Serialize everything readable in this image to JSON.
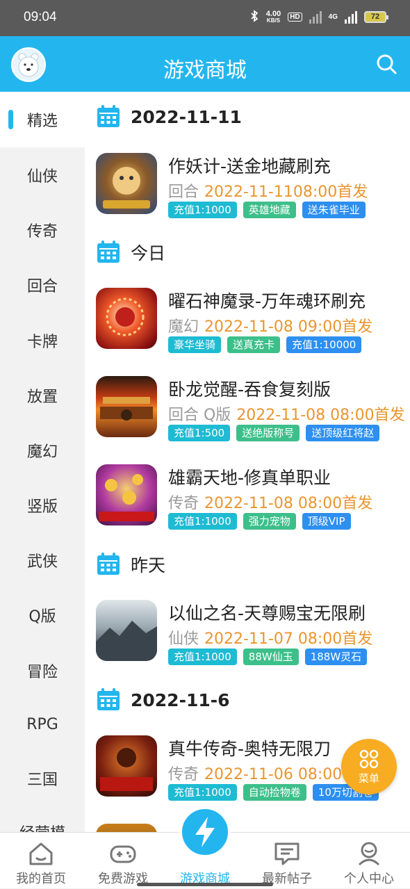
{
  "status": {
    "time": "09:04",
    "net_speed": "4.00",
    "net_unit": "KB/S",
    "hd": "HD",
    "sig": "4G",
    "battery": "72"
  },
  "header": {
    "title": "游戏商城"
  },
  "sidebar": {
    "items": [
      "精选",
      "仙侠",
      "传奇",
      "回合",
      "卡牌",
      "放置",
      "魔幻",
      "竖版",
      "武侠",
      "Q版",
      "冒险",
      "RPG",
      "三国",
      "经营模"
    ]
  },
  "sections": [
    {
      "date": "2022-11-11"
    },
    {
      "date": "今日"
    },
    {
      "date": "昨天"
    },
    {
      "date": "2022-11-6"
    }
  ],
  "games": [
    {
      "name": "作妖计-送金地藏刷充",
      "category": "回合",
      "release": "2022-11-1108:00首发",
      "tags": [
        "充值1:1000",
        "英雄地藏",
        "送朱雀毕业"
      ]
    },
    {
      "name": "曜石神魔录-万年魂环刷充",
      "category": "魔幻",
      "release": "2022-11-08 09:00首发",
      "tags": [
        "豪华坐骑",
        "送真充卡",
        "充值1:10000"
      ]
    },
    {
      "name": "卧龙觉醒-吞食复刻版",
      "category": "回合 Q版",
      "release": "2022-11-08 08:00首发",
      "tags": [
        "充值1:500",
        "送绝版称号",
        "送顶级红将赵"
      ]
    },
    {
      "name": "雄霸天地-修真单职业",
      "category": "传奇",
      "release": "2022-11-08 08:00首发",
      "tags": [
        "充值1:1000",
        "强力宠物",
        "顶级VIP"
      ]
    },
    {
      "name": "以仙之名-天尊赐宝无限刷",
      "category": "仙侠",
      "release": "2022-11-07 08:00首发",
      "tags": [
        "充值1:1000",
        "88W仙玉",
        "188W灵石"
      ]
    },
    {
      "name": "真牛传奇-奥特无限刀",
      "category": "传奇",
      "release": "2022-11-06 08:00首发",
      "tags": [
        "充值1:1000",
        "自动捡物卷",
        "10万切割卷"
      ]
    }
  ],
  "float_menu": {
    "label": "菜单"
  },
  "tabbar": {
    "items": [
      "我的首页",
      "免费游戏",
      "游戏商城",
      "最新帖子",
      "个人中心"
    ]
  },
  "colors": {
    "accent": "#23b6ee",
    "release": "#e8962f",
    "menu": "#f8ac22"
  }
}
